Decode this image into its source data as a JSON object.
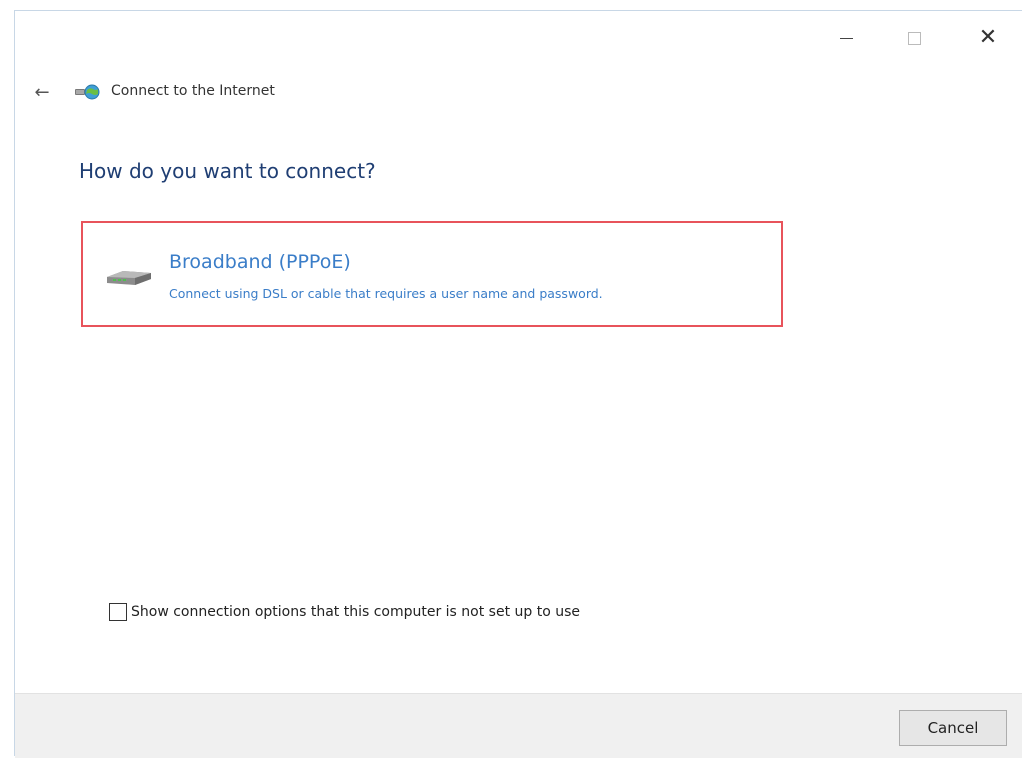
{
  "window": {
    "title": "Connect to the Internet"
  },
  "titlebar": {
    "minimize_icon": "minimize-icon",
    "maximize_icon": "maximize-icon",
    "close_glyph": "✕"
  },
  "nav": {
    "back_glyph": "←"
  },
  "main": {
    "heading": "How do you want to connect?",
    "options": [
      {
        "title": "Broadband (PPPoE)",
        "description": "Connect using DSL or cable that requires a user name and password.",
        "icon": "broadband-modem-icon"
      }
    ],
    "show_options_label": "Show connection options that this computer is not set up to use",
    "show_options_checked": false
  },
  "footer": {
    "cancel_label": "Cancel"
  },
  "colors": {
    "heading": "#1f3e73",
    "link": "#3a7dc8",
    "highlight_border": "#e8535b",
    "footer_bg": "#f0f0f0"
  }
}
